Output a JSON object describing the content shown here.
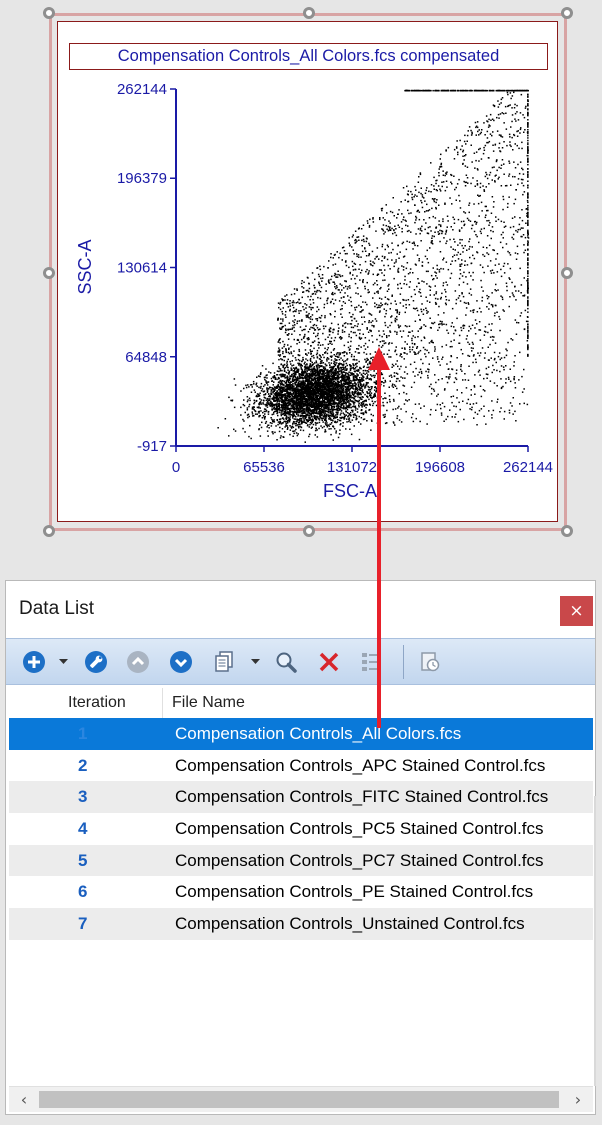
{
  "plot": {
    "title": "Compensation Controls_All Colors.fcs compensated",
    "chart_data": {
      "type": "scatter",
      "x_label": "FSC-A",
      "y_label": "SSC-A",
      "x_ticks": [
        "0",
        "65536",
        "131072",
        "196608",
        "262144"
      ],
      "y_ticks": [
        "-917",
        "64848",
        "130614",
        "196379",
        "262144"
      ],
      "xlim": [
        0,
        262144
      ],
      "ylim": [
        -917,
        262144
      ],
      "population_summary": {
        "dense_cluster_center": [
          103000,
          38000
        ],
        "sparse_tail_direction": "upper-right"
      }
    }
  },
  "data_list": {
    "title": "Data List",
    "close_glyph": "×",
    "columns": [
      "Iteration",
      "File Name"
    ],
    "selected_index": 0,
    "rows": [
      {
        "iteration": "1",
        "file": "Compensation Controls_All Colors.fcs"
      },
      {
        "iteration": "2",
        "file": "Compensation Controls_APC Stained Control.fcs"
      },
      {
        "iteration": "3",
        "file": "Compensation Controls_FITC Stained Control.fcs"
      },
      {
        "iteration": "4",
        "file": "Compensation Controls_PC5 Stained Control.fcs"
      },
      {
        "iteration": "5",
        "file": "Compensation Controls_PC7 Stained Control.fcs"
      },
      {
        "iteration": "6",
        "file": "Compensation Controls_PE Stained Control.fcs"
      },
      {
        "iteration": "7",
        "file": "Compensation Controls_Unstained Control.fcs"
      }
    ],
    "toolbar": [
      "add-icon",
      "wrench-icon",
      "move-up-icon",
      "move-down-icon",
      "copy-icon",
      "search-icon",
      "delete-icon",
      "list-options-icon",
      "history-icon"
    ]
  },
  "colors": {
    "selection": "#0a79d9",
    "axis": "#1a1aa6",
    "plot_border": "#8b1a1a",
    "arrow": "#e8202a"
  }
}
